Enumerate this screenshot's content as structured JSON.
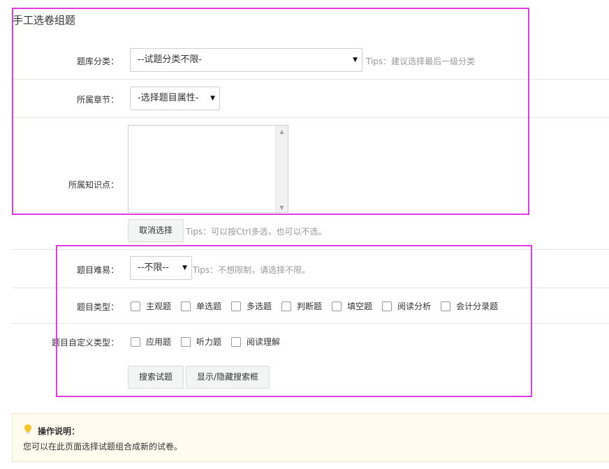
{
  "page": {
    "title": "手工选卷组题"
  },
  "form": {
    "category": {
      "label": "题库分类：",
      "value": "--试题分类不限-",
      "tips": "Tips：建议选择最后一级分类"
    },
    "chapter": {
      "label": "所属章节：",
      "value": "-选择题目属性-"
    },
    "knowledge": {
      "label": "所属知识点：",
      "options": []
    },
    "clear_button": "取消选择",
    "clear_tips": "Tips：可以按Ctrl多选，也可以不选。",
    "difficulty": {
      "label": "题目难易：",
      "value": "--不限--",
      "tips": "Tips：不想限制，请选择不限。"
    },
    "question_type": {
      "label": "题目类型：",
      "options": [
        "主观题",
        "单选题",
        "多选题",
        "判断题",
        "填空题",
        "阅读分析",
        "会计分录题"
      ]
    },
    "custom_type": {
      "label": "题目自定义类型：",
      "options": [
        "应用题",
        "听力题",
        "阅读理解"
      ]
    },
    "search_button": "搜索试题",
    "toggle_button": "显示/隐藏搜索框"
  },
  "notice": {
    "title": "操作说明：",
    "text": "您可以在此页面选择试题组合成新的试卷。"
  },
  "colors": {
    "highlight": "#e33be3",
    "tips": "#999999",
    "notice_bg": "#fffcef"
  }
}
